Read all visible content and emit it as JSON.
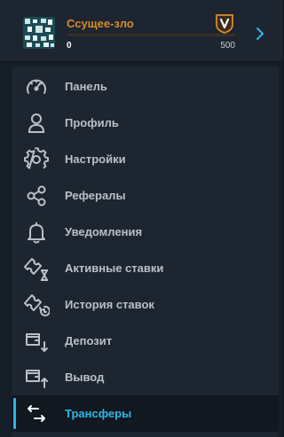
{
  "user": {
    "name": "Ссущее-зло",
    "xp_current": "0",
    "xp_next": "500",
    "level_progress": 0,
    "accent_color": "#d98a2a"
  },
  "menu": {
    "active_color": "#2fb6e8",
    "items": [
      {
        "label": "Панель",
        "icon": "gauge-icon"
      },
      {
        "label": "Профиль",
        "icon": "user-icon"
      },
      {
        "label": "Настройки",
        "icon": "gear-icon"
      },
      {
        "label": "Рефералы",
        "icon": "share-icon"
      },
      {
        "label": "Уведомления",
        "icon": "bell-icon"
      },
      {
        "label": "Активные ставки",
        "icon": "ticket-hourglass-icon"
      },
      {
        "label": "История ставок",
        "icon": "ticket-history-icon"
      },
      {
        "label": "Депозит",
        "icon": "wallet-in-icon"
      },
      {
        "label": "Вывод",
        "icon": "wallet-out-icon"
      },
      {
        "label": "Трансферы",
        "icon": "transfer-icon",
        "active": true
      }
    ]
  }
}
